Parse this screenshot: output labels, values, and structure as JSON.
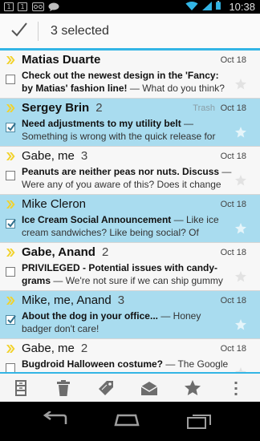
{
  "status_bar": {
    "time": "10:38",
    "notifications": [
      "1",
      "1"
    ]
  },
  "action_bar": {
    "title": "3 selected",
    "done_icon": "check-icon"
  },
  "messages": [
    {
      "sender": "Matias Duarte",
      "count": "",
      "date": "Oct 18",
      "label": "",
      "subject": "Check out the newest design in the 'Fancy: by Matias' fashion line!",
      "snippet": " — What do you think?",
      "selected": false,
      "unread": true
    },
    {
      "sender": "Sergey Brin",
      "count": "2",
      "date": "Oct 18",
      "label": "Trash",
      "subject": "Need adjustments to my utility belt",
      "snippet": " — Something is wrong with the quick release for",
      "selected": true,
      "unread": true
    },
    {
      "sender": "Gabe, me",
      "count": "3",
      "date": "Oct 18",
      "label": "",
      "subject": "Peanuts are neither peas nor nuts. Discuss",
      "snippet": " — Were any of you aware of this? Does it change",
      "selected": false,
      "unread": false
    },
    {
      "sender": "Mike Cleron",
      "count": "",
      "date": "Oct 18",
      "label": "",
      "subject": "Ice Cream Social Announcement",
      "snippet": " — Like ice cream sandwiches? Like being social? Of",
      "selected": true,
      "unread": false
    },
    {
      "sender": "Gabe, Anand",
      "count": "2",
      "date": "Oct 18",
      "label": "",
      "subject": "PRIVILEGED - Potential issues with candy-grams",
      "snippet": " — We're not sure if we can ship gummy",
      "selected": false,
      "unread": true
    },
    {
      "sender": "Mike, me, Anand",
      "count": "3",
      "date": "Oct 18",
      "label": "",
      "subject": "About the dog in your office...",
      "snippet": " — Honey badger don't care!",
      "selected": true,
      "unread": false
    },
    {
      "sender": "Gabe, me",
      "count": "2",
      "date": "Oct 18",
      "label": "",
      "subject": "Bugdroid Halloween costume?",
      "snippet": " — The Google",
      "selected": false,
      "unread": false
    }
  ],
  "bottom_actions": [
    "archive-icon",
    "trash-icon",
    "label-icon",
    "mark-unread-icon",
    "star-icon",
    "overflow-menu-icon"
  ],
  "colors": {
    "accent": "#33b5e5",
    "selected_row": "#a9dcef",
    "chevron": "#f2d22a"
  }
}
